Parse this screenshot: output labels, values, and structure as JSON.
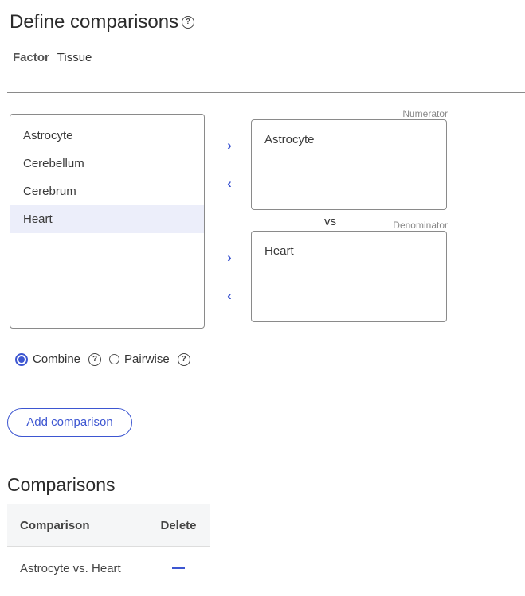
{
  "title": "Define comparisons",
  "factor": {
    "label": "Factor",
    "value": "Tissue"
  },
  "list": {
    "items": [
      {
        "label": "Astrocyte",
        "selected": false
      },
      {
        "label": "Cerebellum",
        "selected": false
      },
      {
        "label": "Cerebrum",
        "selected": false
      },
      {
        "label": "Heart",
        "selected": true
      }
    ]
  },
  "numerator": {
    "caption": "Numerator",
    "value": "Astrocyte"
  },
  "vs_label": "vs",
  "denominator": {
    "caption": "Denominator",
    "value": "Heart"
  },
  "mode": {
    "options": [
      {
        "label": "Combine",
        "checked": true
      },
      {
        "label": "Pairwise",
        "checked": false
      }
    ]
  },
  "add_button_label": "Add comparison",
  "comparisons": {
    "title": "Comparisons",
    "headers": {
      "comparison": "Comparison",
      "delete": "Delete"
    },
    "rows": [
      {
        "comparison": "Astrocyte vs. Heart"
      }
    ]
  },
  "icons": {
    "help": "help-circle-icon",
    "move_right": "chevron-right-icon",
    "move_left": "chevron-left-icon",
    "delete": "minus-icon"
  },
  "colors": {
    "accent": "#3d56d1",
    "selected_row": "#eceefa"
  }
}
